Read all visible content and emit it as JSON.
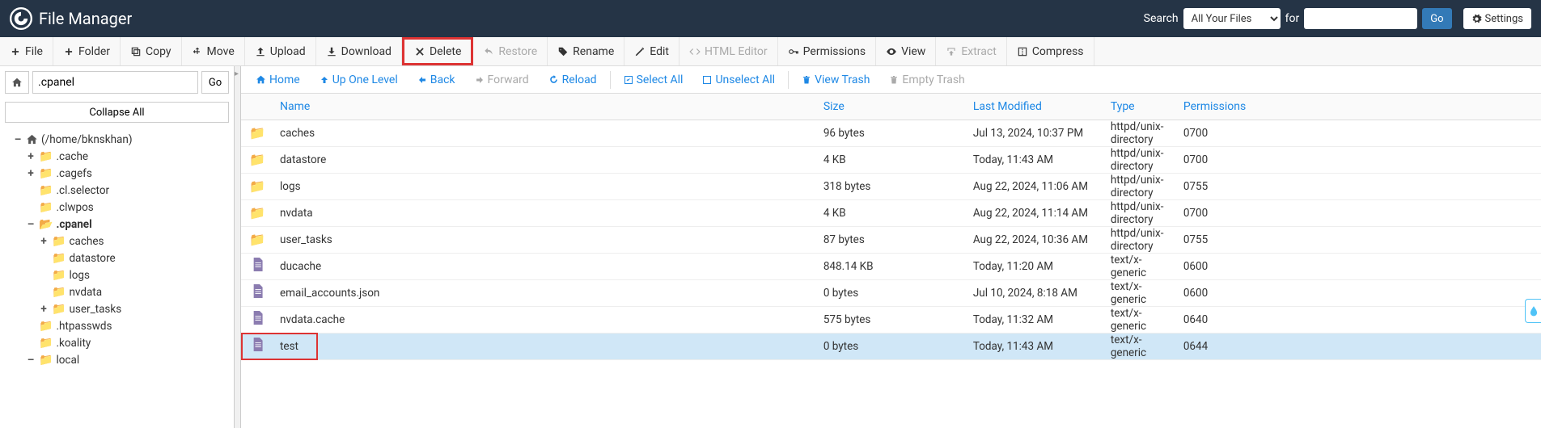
{
  "header": {
    "app_title": "File Manager",
    "search_label": "Search",
    "search_scope": "All Your Files",
    "for_label": "for",
    "go_label": "Go",
    "settings_label": "Settings"
  },
  "toolbar": [
    {
      "icon": "plus",
      "label": "File"
    },
    {
      "icon": "plus",
      "label": "Folder"
    },
    {
      "icon": "copy",
      "label": "Copy"
    },
    {
      "icon": "move",
      "label": "Move"
    },
    {
      "icon": "upload",
      "label": "Upload"
    },
    {
      "icon": "download",
      "label": "Download"
    },
    {
      "icon": "x",
      "label": "Delete",
      "highlight": true
    },
    {
      "icon": "undo",
      "label": "Restore",
      "disabled": true
    },
    {
      "icon": "tag",
      "label": "Rename"
    },
    {
      "icon": "pencil",
      "label": "Edit"
    },
    {
      "icon": "code",
      "label": "HTML Editor",
      "disabled": true
    },
    {
      "icon": "key",
      "label": "Permissions"
    },
    {
      "icon": "eye",
      "label": "View"
    },
    {
      "icon": "extract",
      "label": "Extract",
      "disabled": true
    },
    {
      "icon": "compress",
      "label": "Compress"
    }
  ],
  "sidebar": {
    "path_value": ".cpanel",
    "go_label": "Go",
    "collapse_label": "Collapse All",
    "tree": [
      {
        "depth": 0,
        "toggle": "–",
        "icon": "home",
        "label": "(/home/bknskhan)"
      },
      {
        "depth": 1,
        "toggle": "+",
        "icon": "folder",
        "label": ".cache"
      },
      {
        "depth": 1,
        "toggle": "+",
        "icon": "folder",
        "label": ".cagefs"
      },
      {
        "depth": 1,
        "toggle": "",
        "icon": "folder",
        "label": ".cl.selector"
      },
      {
        "depth": 1,
        "toggle": "",
        "icon": "folder",
        "label": ".clwpos"
      },
      {
        "depth": 1,
        "toggle": "–",
        "icon": "folder-open",
        "label": ".cpanel",
        "bold": true
      },
      {
        "depth": 2,
        "toggle": "+",
        "icon": "folder",
        "label": "caches"
      },
      {
        "depth": 2,
        "toggle": "",
        "icon": "folder",
        "label": "datastore"
      },
      {
        "depth": 2,
        "toggle": "",
        "icon": "folder",
        "label": "logs"
      },
      {
        "depth": 2,
        "toggle": "",
        "icon": "folder",
        "label": "nvdata"
      },
      {
        "depth": 2,
        "toggle": "+",
        "icon": "folder",
        "label": "user_tasks"
      },
      {
        "depth": 1,
        "toggle": "",
        "icon": "folder",
        "label": ".htpasswds"
      },
      {
        "depth": 1,
        "toggle": "",
        "icon": "folder",
        "label": ".koality"
      },
      {
        "depth": 1,
        "toggle": "–",
        "icon": "folder",
        "label": "local"
      }
    ]
  },
  "actionbar": {
    "home": "Home",
    "up": "Up One Level",
    "back": "Back",
    "forward": "Forward",
    "reload": "Reload",
    "select_all": "Select All",
    "unselect_all": "Unselect All",
    "view_trash": "View Trash",
    "empty_trash": "Empty Trash"
  },
  "columns": [
    "Name",
    "Size",
    "Last Modified",
    "Type",
    "Permissions"
  ],
  "files": [
    {
      "icon": "folder",
      "name": "caches",
      "size": "96 bytes",
      "modified": "Jul 13, 2024, 10:37 PM",
      "type": "httpd/unix-directory",
      "perms": "0700"
    },
    {
      "icon": "folder",
      "name": "datastore",
      "size": "4 KB",
      "modified": "Today, 11:43 AM",
      "type": "httpd/unix-directory",
      "perms": "0700"
    },
    {
      "icon": "folder",
      "name": "logs",
      "size": "318 bytes",
      "modified": "Aug 22, 2024, 11:06 AM",
      "type": "httpd/unix-directory",
      "perms": "0755"
    },
    {
      "icon": "folder",
      "name": "nvdata",
      "size": "4 KB",
      "modified": "Aug 22, 2024, 11:14 AM",
      "type": "httpd/unix-directory",
      "perms": "0700"
    },
    {
      "icon": "folder",
      "name": "user_tasks",
      "size": "87 bytes",
      "modified": "Aug 22, 2024, 10:36 AM",
      "type": "httpd/unix-directory",
      "perms": "0755"
    },
    {
      "icon": "file",
      "name": "ducache",
      "size": "848.14 KB",
      "modified": "Today, 11:20 AM",
      "type": "text/x-generic",
      "perms": "0600"
    },
    {
      "icon": "file",
      "name": "email_accounts.json",
      "size": "0 bytes",
      "modified": "Jul 10, 2024, 8:18 AM",
      "type": "text/x-generic",
      "perms": "0600"
    },
    {
      "icon": "file",
      "name": "nvdata.cache",
      "size": "575 bytes",
      "modified": "Today, 11:32 AM",
      "type": "text/x-generic",
      "perms": "0640"
    },
    {
      "icon": "file",
      "name": "test",
      "size": "0 bytes",
      "modified": "Today, 11:43 AM",
      "type": "text/x-generic",
      "perms": "0644",
      "selected": true,
      "highlight": true
    }
  ]
}
